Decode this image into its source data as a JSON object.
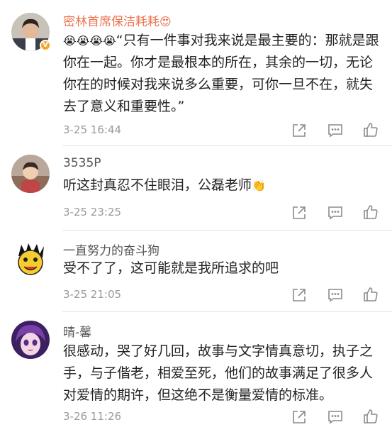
{
  "comments": [
    {
      "username": "密林首席保洁耗耗",
      "username_suffix_emoji": "😍",
      "verified": true,
      "lead_emojis": "😭😭😭😭",
      "text": "“只有一件事对我来说是最主要的：那就是跟你在一起。你才是最根本的所在，其余的一切，无论你在的时候对我来说多么重要，可你一旦不在，就失去了意义和重要性。”",
      "time": "3-25 16:44"
    },
    {
      "username": "3535P",
      "text": "听这封真忍不住眼泪，公磊老师",
      "trailing_emoji": "👏",
      "time": "3-25 23:25"
    },
    {
      "username": "一直努力的奋斗狗",
      "text": "受不了了，这可能就是我所追求的吧",
      "time": "3-25 21:05"
    },
    {
      "username": "晴-馨",
      "text": "很感动，哭了好几回，故事与文字情真意切，执子之手，与子偕老，相爱至死，他们的故事满足了很多人对爱情的期许，但这绝不是衡量爱情的标准。",
      "time": "3-26 11:26"
    }
  ],
  "icons": {
    "repost": "repost-icon",
    "comment": "comment-icon",
    "like": "like-icon",
    "verified": "verified-badge-icon"
  },
  "colors": {
    "vip_username": "#eb7350",
    "username": "#555555",
    "time": "#9a9a9a",
    "icon": "#8a8a8a",
    "divider": "#e6e6e6",
    "verified_badge": "#f5a623"
  }
}
